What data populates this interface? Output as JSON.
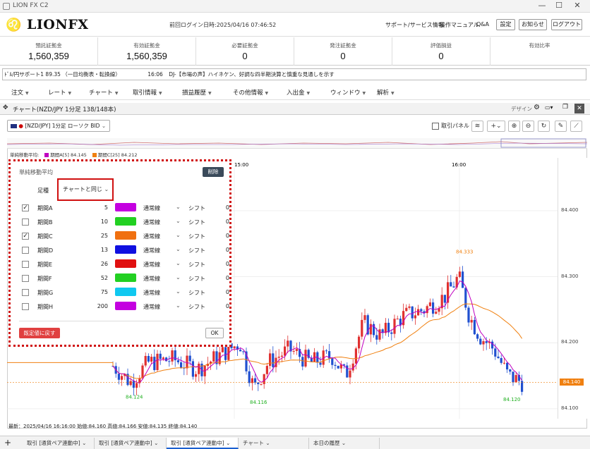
{
  "window": {
    "title": "LION FX C2",
    "minimize": "—",
    "maximize": "☐",
    "close": "✕"
  },
  "header": {
    "logo": "LIONFX",
    "last_login": "前回ログイン日時:2025/04/16 07:46:52",
    "links": [
      "サポート/サービス情報",
      "操作マニュアル",
      "Q&A"
    ],
    "buttons": [
      "設定",
      "お知らせ",
      "ログアウト"
    ]
  },
  "balance": [
    {
      "label": "預託証拠金",
      "value": "1,560,359"
    },
    {
      "label": "有効証拠金",
      "value": "1,560,359"
    },
    {
      "label": "必要証拠金",
      "value": "0"
    },
    {
      "label": "発注証拠金",
      "value": "0"
    },
    {
      "label": "評価損益",
      "value": "0"
    },
    {
      "label": "有効比率",
      "value": ""
    }
  ],
  "ticker": {
    "left": "ﾄﾞﾙ/円サポート1  89.35 （一目均衡表・転換線）",
    "time": "16:06",
    "headline": "DJ-【市場の声】ハイネケン、好調な四半期決算と慎重な見通しを示す"
  },
  "menu": [
    "注文",
    "レート",
    "チャート",
    "取引情報",
    "損益履歴",
    "その他情報",
    "入出金",
    "ウィンドウ",
    "解析"
  ],
  "chart_window": {
    "title": "チャート(NZD/JPY 1分足 138/148本)",
    "design_label": "デザイン",
    "symbol": "[NZD/JPY] 1分足 ローソク BID",
    "trade_panel": "取引パネル",
    "legend_title": "単純移動平均:",
    "legend_a": "期間A[5] 84.145",
    "legend_c": "期間C[25] 84.212",
    "time_labels": [
      "15:00",
      "16:00"
    ],
    "status_line": "最新：2025/04/16 16:16:00  始値:84.160  高値:84.166  安値:84.135  終値:84.140",
    "current_price": "84.140"
  },
  "chart_data": {
    "type": "candlestick",
    "y_ticks": [
      "84.400",
      "84.300",
      "84.200",
      "84.100"
    ],
    "ylim": [
      84.085,
      84.48
    ],
    "high_label": "84.333",
    "low_labels": [
      "84.124",
      "84.116",
      "84.120"
    ],
    "last_price": 84.14,
    "colors": {
      "up": "#e03030",
      "down": "#2050d0",
      "ma_a": "#c000c0",
      "ma_c": "#f08010"
    }
  },
  "popup": {
    "title": "単純移動平均",
    "delete_button": "削除",
    "foot_label": "足種",
    "foot_value": "チャートと同じ",
    "rows": [
      {
        "name": "期間A",
        "period": "5",
        "checked": true,
        "color": "#c400e0",
        "line": "通常線",
        "shift": "シフト",
        "shift_value": "0"
      },
      {
        "name": "期間B",
        "period": "10",
        "checked": false,
        "color": "#22d022",
        "line": "通常線",
        "shift": "シフト",
        "shift_value": "0"
      },
      {
        "name": "期間C",
        "period": "25",
        "checked": true,
        "color": "#f07010",
        "line": "通常線",
        "shift": "シフト",
        "shift_value": "0"
      },
      {
        "name": "期間D",
        "period": "13",
        "checked": false,
        "color": "#1010e0",
        "line": "通常線",
        "shift": "シフト",
        "shift_value": "0"
      },
      {
        "name": "期間E",
        "period": "26",
        "checked": false,
        "color": "#e01010",
        "line": "通常線",
        "shift": "シフト",
        "shift_value": "0"
      },
      {
        "name": "期間F",
        "period": "52",
        "checked": false,
        "color": "#22d022",
        "line": "通常線",
        "shift": "シフト",
        "shift_value": "0"
      },
      {
        "name": "期間G",
        "period": "75",
        "checked": false,
        "color": "#10c8f0",
        "line": "通常線",
        "shift": "シフト",
        "shift_value": "0"
      },
      {
        "name": "期間H",
        "period": "200",
        "checked": false,
        "color": "#c400e0",
        "line": "通常線",
        "shift": "シフト",
        "shift_value": "0"
      }
    ],
    "reset_button": "既定値に戻す",
    "ok_button": "OK"
  },
  "bottom_tabs": [
    "取引 [通貨ペア連動中]",
    "取引 [通貨ペア連動中]",
    "取引 [通貨ペア連動中]",
    "チャート",
    "本日の履歴"
  ],
  "bottom_add": "+"
}
